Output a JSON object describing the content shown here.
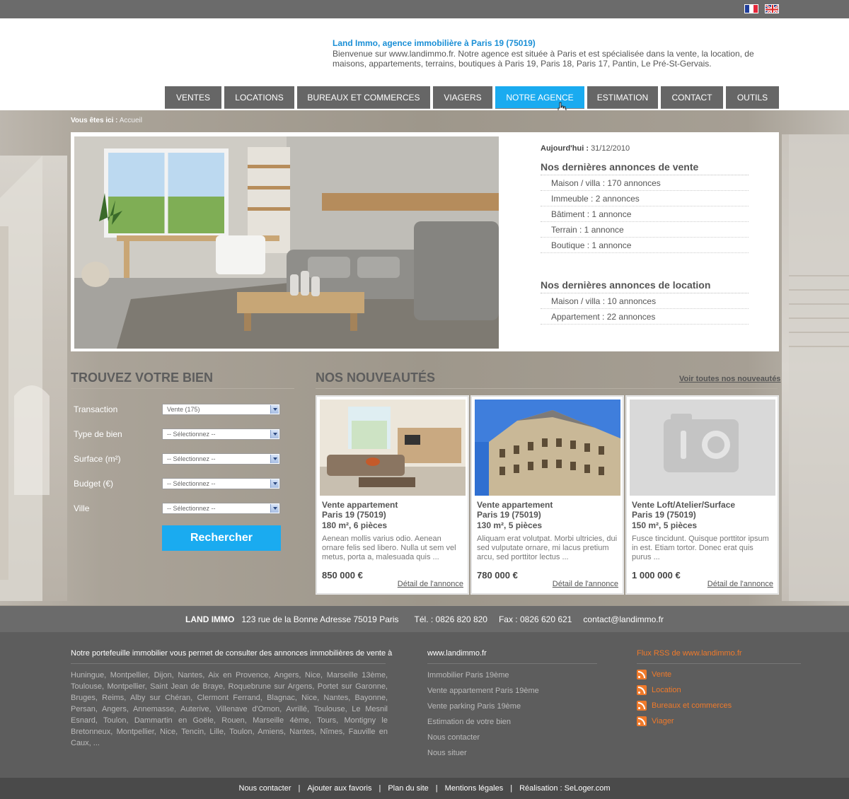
{
  "header": {
    "title": "Land Immo, agence immobilière à Paris 19 (75019)",
    "intro": "Bienvenue sur www.landimmo.fr. Notre agence est située à Paris et est spécialisée dans la vente, la location, de maisons, appartements, terrains, boutiques à Paris 19, Paris 18, Paris 17, Pantin, Le Pré-St-Gervais."
  },
  "nav": {
    "items": [
      "VENTES",
      "LOCATIONS",
      "BUREAUX ET COMMERCES",
      "VIAGERS",
      "NOTRE AGENCE",
      "ESTIMATION",
      "CONTACT",
      "OUTILS"
    ],
    "active": "NOTRE AGENCE",
    "active_color": "#1aabf0"
  },
  "breadcrumb": {
    "label": "Vous êtes ici :",
    "current": "Accueil"
  },
  "hero": {
    "today_label": "Aujourd'hui :",
    "today_date": "31/12/2010",
    "sales_title": "Nos dernières annonces de vente",
    "sales": [
      "Maison / villa : 170 annonces",
      "Immeuble : 2 annonces",
      "Bâtiment : 1 annonce",
      "Terrain : 1 annonce",
      "Boutique : 1 annonce"
    ],
    "rentals_title": "Nos dernières annonces de location",
    "rentals": [
      "Maison / villa : 10 annonces",
      "Appartement : 22 annonces"
    ]
  },
  "search": {
    "title": "TROUVEZ VOTRE BIEN",
    "fields": [
      {
        "label": "Transaction",
        "value": "Vente (175)"
      },
      {
        "label": "Type de bien",
        "value": "-- Sélectionnez --"
      },
      {
        "label": "Surface (m²)",
        "value": "-- Sélectionnez --"
      },
      {
        "label": "Budget (€)",
        "value": "-- Sélectionnez --"
      },
      {
        "label": "Ville",
        "value": "-- Sélectionnez --"
      }
    ],
    "button": "Rechercher"
  },
  "news": {
    "title": "NOS NOUVEAUTÉS",
    "see_all": "Voir toutes nos nouveautés",
    "cards": [
      {
        "type": "Vente appartement",
        "city": "Paris 19 (75019)",
        "size": "180 m², 6 pièces",
        "desc": "Aenean mollis varius odio. Aenean ornare felis sed libero. Nulla ut sem vel metus, porta a, malesuada quis ...",
        "price": "850 000 €",
        "link": "Détail de l'annonce"
      },
      {
        "type": "Vente appartement",
        "city": "Paris 19 (75019)",
        "size": "130 m², 5 pièces",
        "desc": "Aliquam erat volutpat. Morbi ultricies, dui sed vulputate ornare, mi lacus pretium arcu, sed porttitor lectus ...",
        "price": "780 000 €",
        "link": "Détail de l'annonce"
      },
      {
        "type": "Vente Loft/Atelier/Surface",
        "city": "Paris 19 (75019)",
        "size": "150 m², 5 pièces",
        "desc": "Fusce tincidunt. Quisque porttitor ipsum in est. Etiam tortor. Donec erat quis purus ...",
        "price": "1 000 000 €",
        "link": "Détail de l'annonce"
      }
    ]
  },
  "contact_bar": {
    "name": "LAND IMMO",
    "address": "123 rue de la Bonne Adresse 75019 Paris",
    "tel": "Tél. : 0826 820 820",
    "fax": "Fax : 0826 620 621",
    "email": "contact@landimmo.fr"
  },
  "footer": {
    "intro": "Notre portefeuille immobilier vous permet de consulter des annonces immobilières de vente à",
    "cities": "Huningue, Montpellier, Dijon, Nantes, Aix en Provence, Angers, Nice, Marseille 13ème, Toulouse, Montpellier, Saint Jean de Braye, Roquebrune sur Argens, Portet sur Garonne, Bruges, Reims, Alby sur Chéran, Clermont Ferrand, Blagnac, Nice, Nantes, Bayonne, Persan, Angers, Annemasse, Auterive, Villenave d'Ornon, Avrillé, Toulouse, Le Mesnil Esnard, Toulon, Dammartin en Goële, Rouen, Marseille 4ème, Tours, Montigny le Bretonneux, Montpellier, Nice, Tencin, Lille, Toulon, Amiens, Nantes, Nîmes, Fauville en Caux, ...",
    "site_title": "www.landimmo.fr",
    "site_links": [
      "Immobilier Paris 19ème",
      "Vente appartement Paris 19ème",
      "Vente parking Paris 19ème",
      "Estimation de votre bien",
      "Nous contacter",
      "Nous situer"
    ],
    "rss_title": "Flux RSS de www.landimmo.fr",
    "rss_links": [
      "Vente",
      "Location",
      "Bureaux et commerces",
      "Viager"
    ],
    "rss_color": "#f07a2a"
  },
  "bottom": {
    "links": [
      "Nous contacter",
      "Ajouter aux favoris",
      "Plan du site",
      "Mentions légales",
      "Réalisation : SeLoger.com"
    ]
  }
}
